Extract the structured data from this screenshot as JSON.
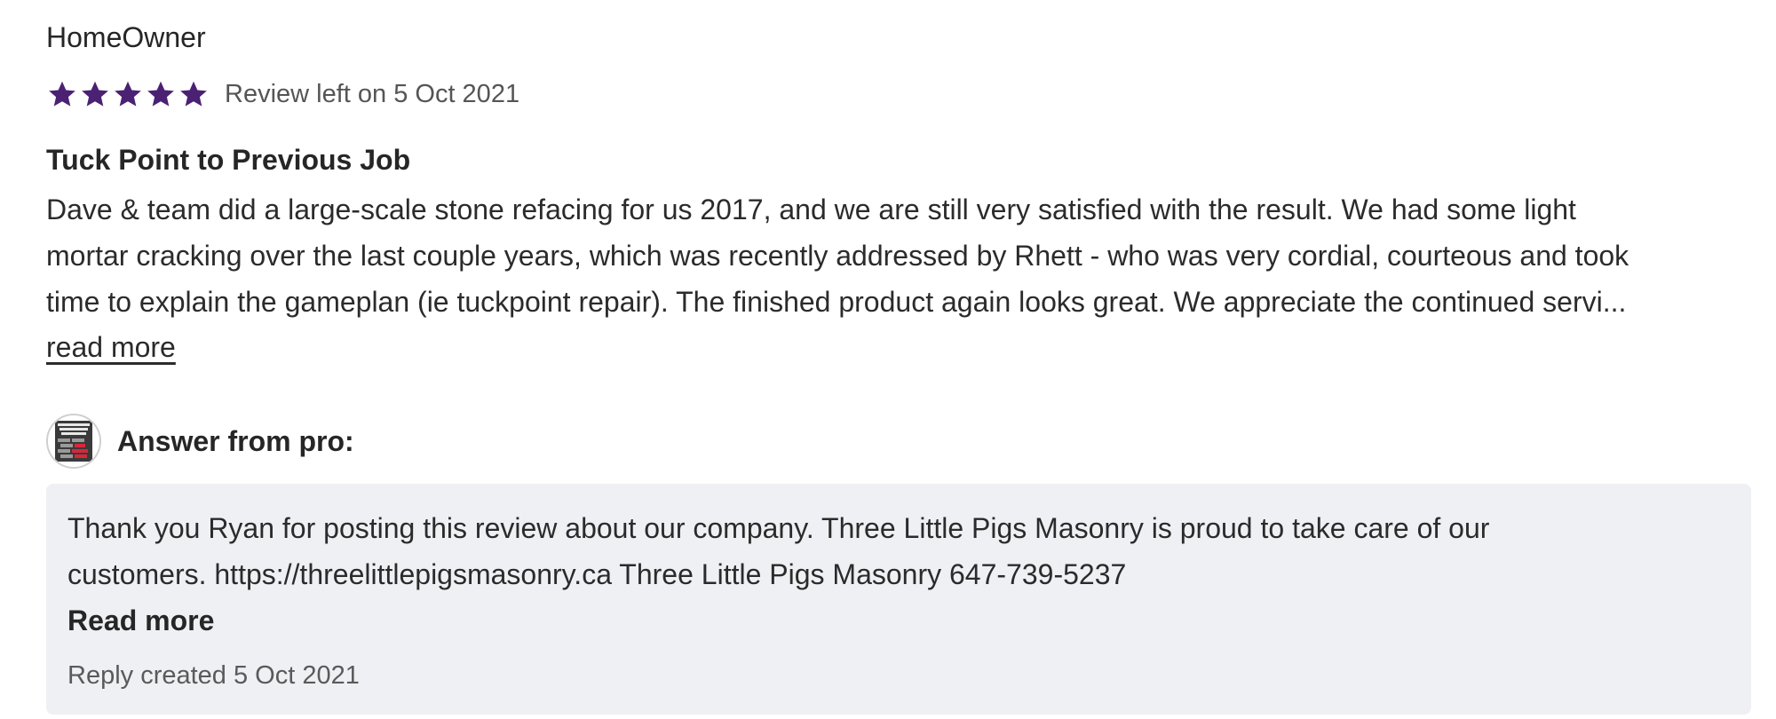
{
  "review": {
    "author": "HomeOwner",
    "rating": 5,
    "rating_max": 5,
    "star_color": "#4b2173",
    "date_text": "Review left on 5 Oct 2021",
    "title": "Tuck Point to Previous Job",
    "body_lines": [
      "Dave & team did a large-scale stone refacing for us 2017, and we are still very satisfied with the result. We had some light",
      "mortar cracking over the last couple years, which was recently addressed by Rhett - who was very cordial, courteous and took",
      "time to explain the gameplan (ie tuckpoint repair). The finished product again looks great. We appreciate the continued servi..."
    ],
    "read_more_label": "read more"
  },
  "answer": {
    "avatar_icon": "three-little-pigs-logo-icon",
    "label": "Answer from pro:",
    "body_lines": [
      "Thank you Ryan for posting this review about our company. Three Little Pigs Masonry is proud to take care of our",
      "customers. https://threelittlepigsmasonry.ca Three Little Pigs Masonry 647-739-5237"
    ],
    "read_more_label": "Read more",
    "date_text": "Reply created 5 Oct 2021",
    "box_color": "#eff0f4"
  }
}
